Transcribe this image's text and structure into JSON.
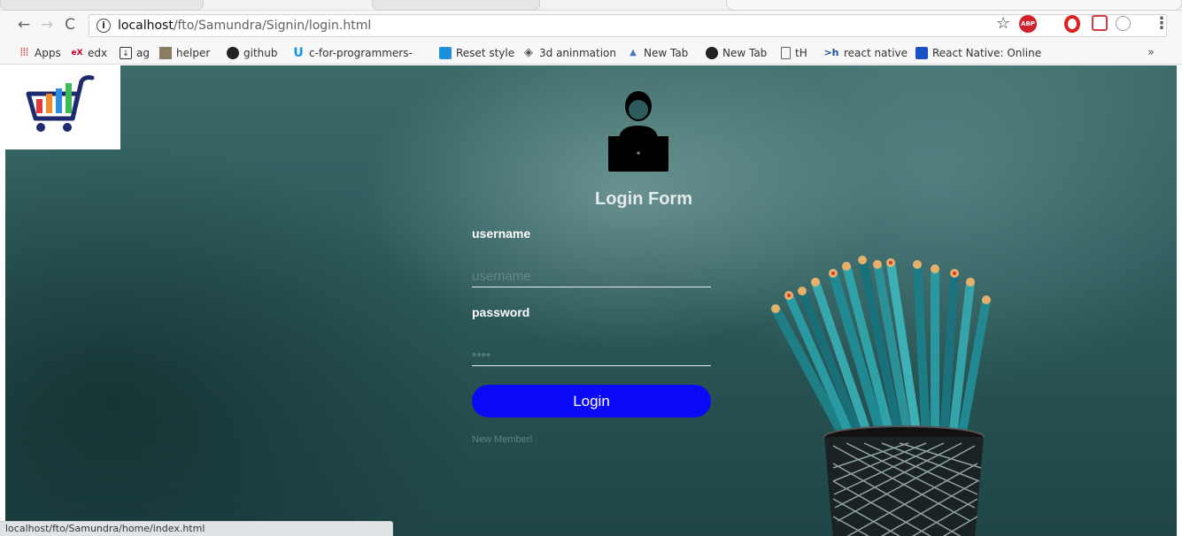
{
  "browser": {
    "url_host": "localhost",
    "url_path": "/fto/Samundra/Signin/login.html",
    "bookmarks": [
      {
        "label": "Apps",
        "icon": "apps-grid-icon"
      },
      {
        "label": "edx",
        "icon": "edx-icon"
      },
      {
        "label": "ag",
        "icon": "download-icon"
      },
      {
        "label": "helper",
        "icon": "image-icon"
      },
      {
        "label": "github",
        "icon": "github-icon"
      },
      {
        "label": "c-for-programmers-",
        "icon": "udacity-icon"
      },
      {
        "label": "Reset style",
        "icon": "reset-icon"
      },
      {
        "label": "3d aninmation",
        "icon": "diamond-icon"
      },
      {
        "label": "New Tab",
        "icon": "newtab-icon"
      },
      {
        "label": "New Tab",
        "icon": "github-icon"
      },
      {
        "label": "tH",
        "icon": "document-icon"
      },
      {
        "label": "react native",
        "icon": "th-icon"
      },
      {
        "label": "React Native: Online",
        "icon": "rn-icon"
      }
    ],
    "more_label": "»",
    "status_url": "localhost/fto/Samundra/home/index.html"
  },
  "login": {
    "title": "Login Form",
    "username_label": "username",
    "username_placeholder": "username",
    "password_label": "password",
    "password_placeholder": "••••",
    "button_label": "Login",
    "new_member_label": "New Member!"
  },
  "colors": {
    "button": "#0a0af7",
    "background": "#2d5a5a"
  }
}
